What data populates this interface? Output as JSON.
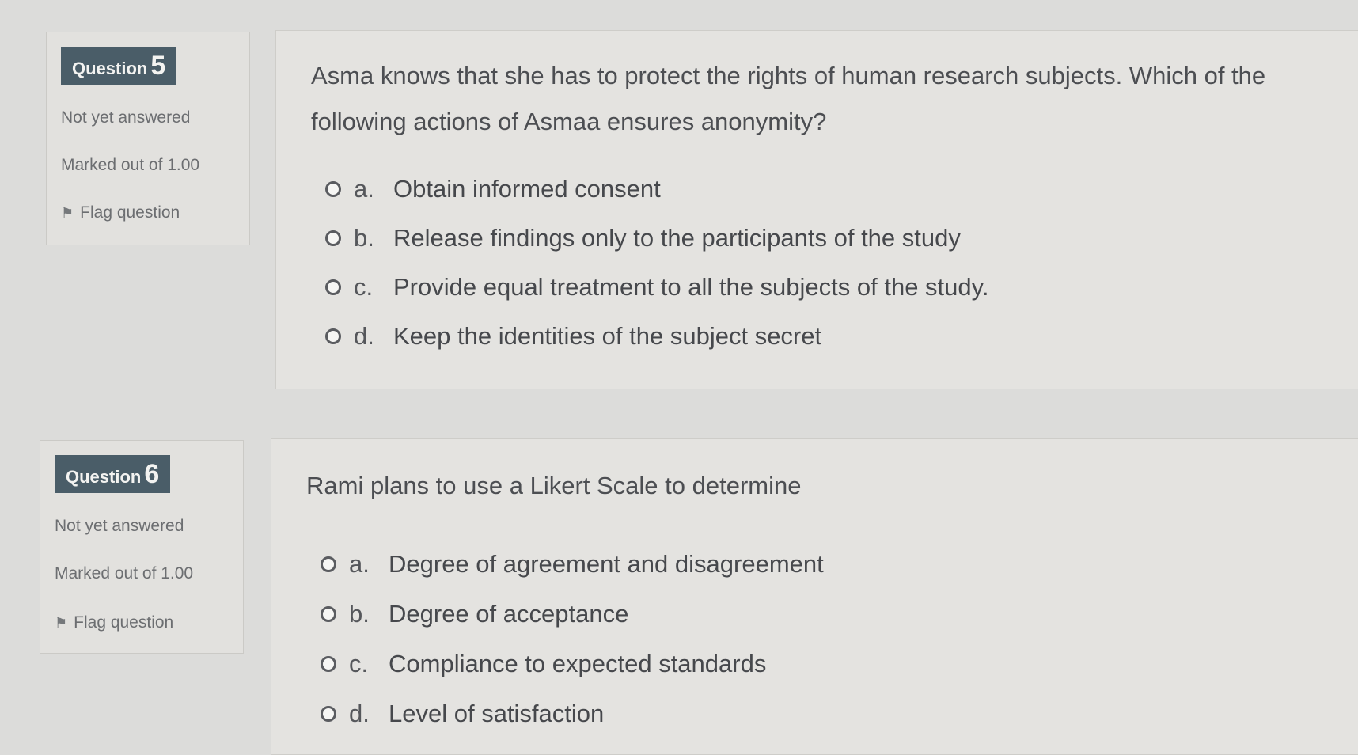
{
  "questions": [
    {
      "label": "Question",
      "number": "5",
      "status": "Not yet answered",
      "marks": "Marked out of 1.00",
      "flag": "Flag question",
      "text_lines": [
        "Asma knows that she has to protect the rights of human research subjects. Which of the",
        "following actions of Asmaa ensures anonymity?"
      ],
      "options": [
        {
          "letter": "a.",
          "text": "Obtain informed consent"
        },
        {
          "letter": "b.",
          "text": "Release findings only to the participants of the study"
        },
        {
          "letter": "c.",
          "text": "Provide equal treatment to all the subjects of the study."
        },
        {
          "letter": "d.",
          "text": "Keep the identities of the subject secret"
        }
      ]
    },
    {
      "label": "Question",
      "number": "6",
      "status": "Not yet answered",
      "marks": "Marked out of 1.00",
      "flag": "Flag question",
      "text_lines": [
        "Rami plans to use a Likert Scale to determine"
      ],
      "options": [
        {
          "letter": "a.",
          "text": "Degree of agreement and disagreement"
        },
        {
          "letter": "b.",
          "text": "Degree of acceptance"
        },
        {
          "letter": "c.",
          "text": "Compliance to expected standards"
        },
        {
          "letter": "d.",
          "text": "Level of satisfaction"
        }
      ]
    }
  ],
  "icons": {
    "flag": "flag-icon",
    "radio": "radio-button-icon"
  }
}
